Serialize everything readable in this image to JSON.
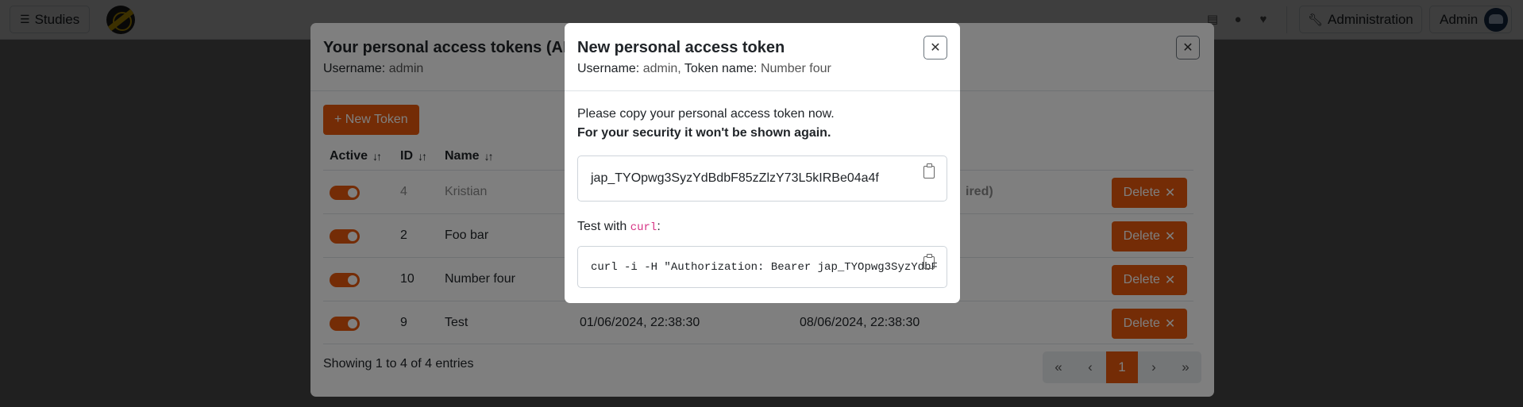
{
  "navbar": {
    "studies_label": "Studies",
    "admin_label": "Administration",
    "user_label": "Admin",
    "icons": [
      "docs-icon",
      "github-icon",
      "heart-icon"
    ]
  },
  "tokens_modal": {
    "title": "Your personal access tokens (API",
    "username_label": "Username:",
    "username": "admin",
    "new_token_label": "+ New Token",
    "columns": [
      "Active",
      "ID",
      "Name"
    ],
    "rows": [
      {
        "id": "4",
        "name": "Kristian",
        "created": "",
        "expires": "ired)",
        "faded": true
      },
      {
        "id": "2",
        "name": "Foo bar",
        "created": "",
        "expires": "",
        "faded": false
      },
      {
        "id": "10",
        "name": "Number four",
        "created": "",
        "expires": "",
        "faded": false
      },
      {
        "id": "9",
        "name": "Test",
        "created": "01/06/2024, 22:38:30",
        "expires": "08/06/2024, 22:38:30",
        "faded": false
      }
    ],
    "delete_label": "Delete",
    "showing": "Showing 1 to 4 of 4 entries",
    "pager": [
      "«",
      "‹",
      "1",
      "›",
      "»"
    ],
    "current_page": "1"
  },
  "new_token_modal": {
    "title": "New personal access token",
    "username_label": "Username:",
    "username": "admin,",
    "token_name_label": "Token name:",
    "token_name": "Number four",
    "copy_notice": "Please copy your personal access token now.",
    "security_notice": "For your security it won't be shown again.",
    "token": "jap_TYOpwg3SyzYdBdbF85zZlzY73L5kIRBe04a4f",
    "test_prefix": "Test with",
    "test_code": "curl",
    "test_suffix": ":",
    "curl_command": "curl -i -H \"Authorization: Bearer jap_TYOpwg3SyzYdbF"
  }
}
